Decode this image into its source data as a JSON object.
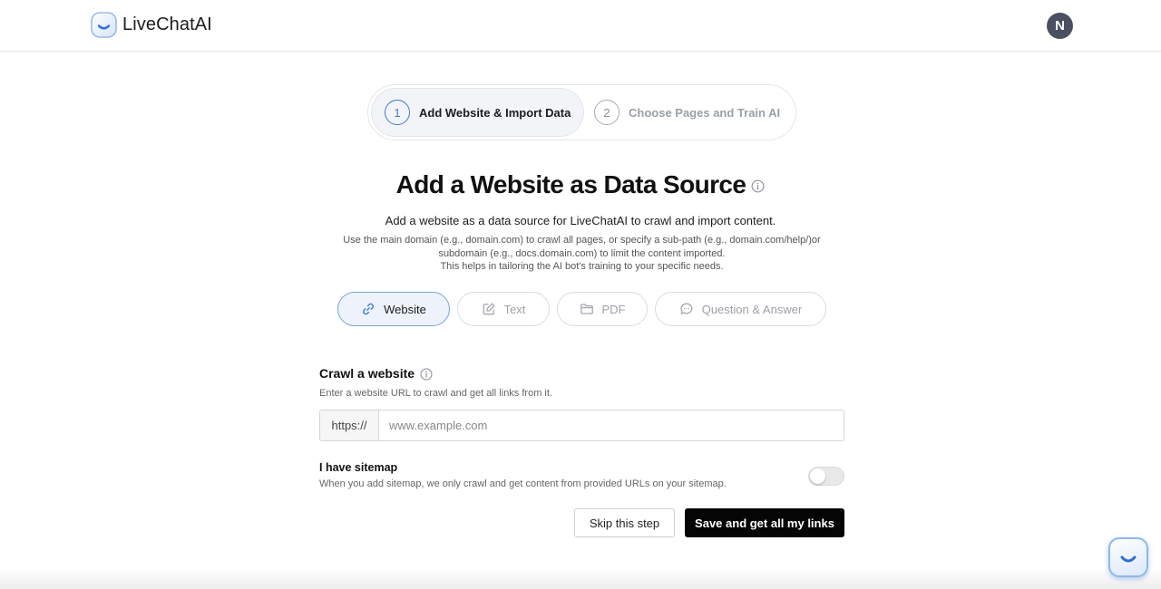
{
  "header": {
    "logo_text": "LiveChatAI",
    "avatar_initial": "N"
  },
  "stepper": {
    "steps": [
      {
        "number": "1",
        "label": "Add Website & Import Data"
      },
      {
        "number": "2",
        "label": "Choose Pages and Train AI"
      }
    ]
  },
  "main": {
    "title": "Add a Website as Data Source",
    "subtitle": "Add a website as a data source for LiveChatAI to crawl and import content.",
    "help_line1": "Use the main domain (e.g., domain.com) to crawl all pages, or specify a sub-path (e.g., domain.com/help/)or",
    "help_line2": "subdomain (e.g., docs.domain.com) to limit the content imported.",
    "help_line3": "This helps in tailoring the AI bot's training to your specific needs."
  },
  "tabs": [
    {
      "label": "Website",
      "icon": "link-icon"
    },
    {
      "label": "Text",
      "icon": "edit-icon"
    },
    {
      "label": "PDF",
      "icon": "folder-icon"
    },
    {
      "label": "Question & Answer",
      "icon": "chat-bubble-icon"
    }
  ],
  "crawl": {
    "title": "Crawl a website",
    "description": "Enter a website URL to crawl and get all links from it.",
    "prefix": "https://",
    "placeholder": "www.example.com",
    "value": ""
  },
  "sitemap": {
    "title": "I have sitemap",
    "description": "When you add sitemap, we only crawl and get content from provided URLs on your sitemap.",
    "enabled": false
  },
  "actions": {
    "skip_label": "Skip this step",
    "save_label": "Save and get all my links"
  },
  "colors": {
    "accent": "#3a7bd5",
    "primary_button": "#050505",
    "active_tab_bg": "#eef3fb"
  }
}
